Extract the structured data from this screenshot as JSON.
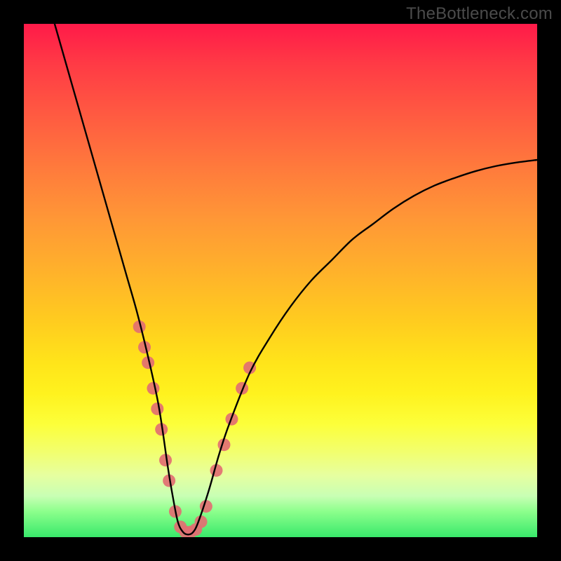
{
  "watermark": "TheBottleneck.com",
  "chart_data": {
    "type": "line",
    "title": "",
    "xlabel": "",
    "ylabel": "",
    "xlim": [
      0,
      100
    ],
    "ylim": [
      0,
      100
    ],
    "gradient_stops": [
      {
        "pos": 0,
        "color": "#ff1a49"
      },
      {
        "pos": 18,
        "color": "#ff5b41"
      },
      {
        "pos": 38,
        "color": "#ff9736"
      },
      {
        "pos": 58,
        "color": "#ffcc1f"
      },
      {
        "pos": 78,
        "color": "#fcff3a"
      },
      {
        "pos": 92,
        "color": "#c8ffb4"
      },
      {
        "pos": 100,
        "color": "#39e96b"
      }
    ],
    "series": [
      {
        "name": "bottleneck-curve",
        "x": [
          6,
          8,
          10,
          12,
          14,
          16,
          18,
          20,
          22,
          24,
          26,
          27,
          28,
          29,
          30,
          31,
          32,
          33,
          34,
          36,
          38,
          40,
          44,
          48,
          52,
          56,
          60,
          64,
          68,
          72,
          76,
          80,
          84,
          88,
          92,
          96,
          100
        ],
        "y": [
          100,
          93,
          86,
          79,
          72,
          65,
          58,
          51,
          44,
          36,
          27,
          21,
          14,
          8,
          3,
          1,
          0.5,
          1,
          3,
          9,
          16,
          22,
          32,
          39,
          45,
          50,
          54,
          58,
          61,
          64,
          66.5,
          68.5,
          70,
          71.3,
          72.3,
          73,
          73.5
        ]
      }
    ],
    "scatter_points": {
      "name": "highlight-dots",
      "color": "#e26f72",
      "radius": 9,
      "points": [
        {
          "x": 22.5,
          "y": 41
        },
        {
          "x": 23.5,
          "y": 37
        },
        {
          "x": 24.2,
          "y": 34
        },
        {
          "x": 25.2,
          "y": 29
        },
        {
          "x": 26.0,
          "y": 25
        },
        {
          "x": 26.8,
          "y": 21
        },
        {
          "x": 27.6,
          "y": 15
        },
        {
          "x": 28.3,
          "y": 11
        },
        {
          "x": 29.5,
          "y": 5
        },
        {
          "x": 30.5,
          "y": 2
        },
        {
          "x": 31.5,
          "y": 1
        },
        {
          "x": 32.5,
          "y": 1
        },
        {
          "x": 33.5,
          "y": 1.5
        },
        {
          "x": 34.5,
          "y": 3
        },
        {
          "x": 35.5,
          "y": 6
        },
        {
          "x": 37.5,
          "y": 13
        },
        {
          "x": 39.0,
          "y": 18
        },
        {
          "x": 40.5,
          "y": 23
        },
        {
          "x": 42.5,
          "y": 29
        },
        {
          "x": 44.0,
          "y": 33
        }
      ]
    }
  }
}
